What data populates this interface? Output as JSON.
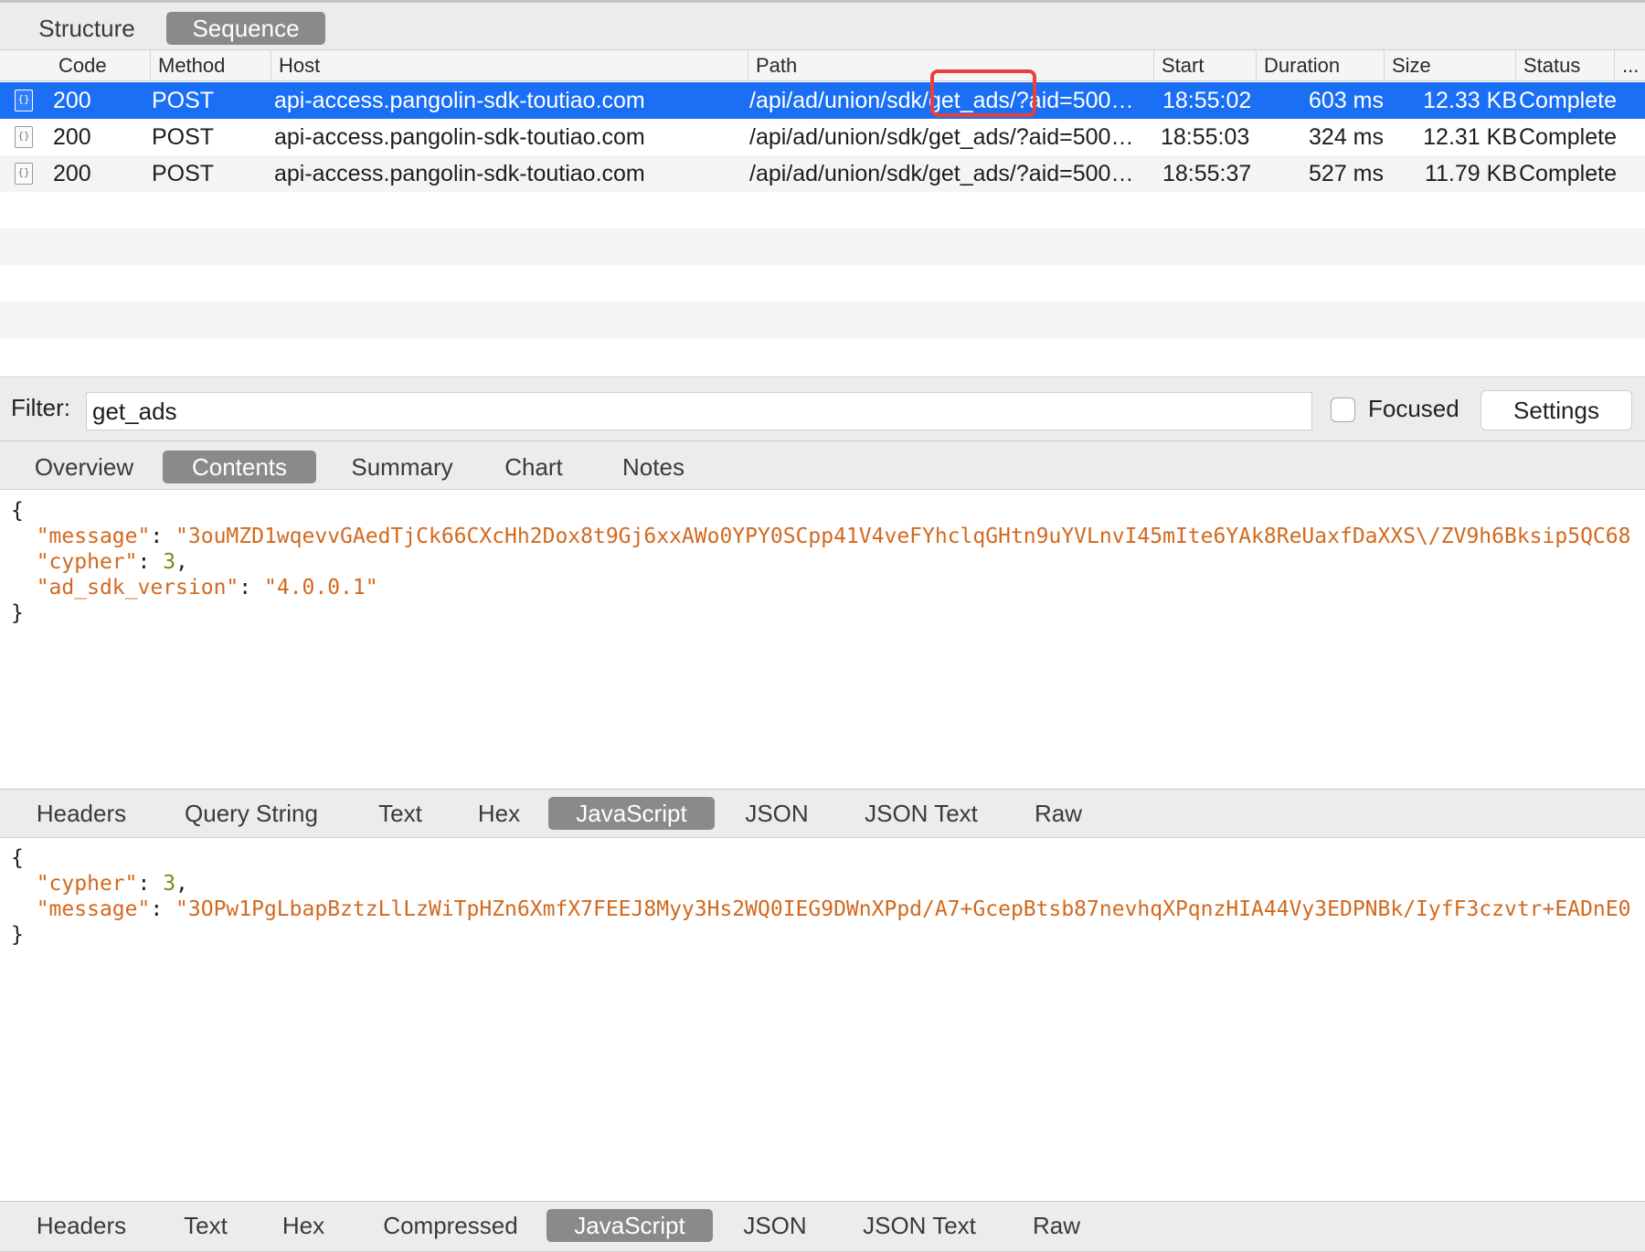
{
  "view_switch": {
    "tabs": [
      "Structure",
      "Sequence"
    ],
    "active": "Sequence"
  },
  "table": {
    "columns": [
      "Code",
      "Method",
      "Host",
      "Path",
      "Start",
      "Duration",
      "Size",
      "Status",
      "..."
    ],
    "rows": [
      {
        "code": "200",
        "method": "POST",
        "host": "api-access.pangolin-sdk-toutiao.com",
        "path": "/api/ad/union/sdk/get_ads/?aid=500…",
        "start": "18:55:02",
        "duration": "603 ms",
        "size": "12.33 KB",
        "status": "Complete",
        "selected": true
      },
      {
        "code": "200",
        "method": "POST",
        "host": "api-access.pangolin-sdk-toutiao.com",
        "path": "/api/ad/union/sdk/get_ads/?aid=500…",
        "start": "18:55:03",
        "duration": "324 ms",
        "size": "12.31 KB",
        "status": "Complete",
        "selected": false
      },
      {
        "code": "200",
        "method": "POST",
        "host": "api-access.pangolin-sdk-toutiao.com",
        "path": "/api/ad/union/sdk/get_ads/?aid=500…",
        "start": "18:55:37",
        "duration": "527 ms",
        "size": "11.79 KB",
        "status": "Complete",
        "selected": false
      }
    ],
    "row_icon": "json-document-icon",
    "highlight_color": "#e8403a",
    "selection_color": "#1a6ff5"
  },
  "filter": {
    "label": "Filter:",
    "value": "get_ads",
    "focused_label": "Focused",
    "focused_checked": false,
    "settings_label": "Settings"
  },
  "detail_tabs": {
    "tabs": [
      "Overview",
      "Contents",
      "Summary",
      "Chart",
      "Notes"
    ],
    "active": "Contents"
  },
  "request_body": {
    "open_brace": "{",
    "close_brace": "}",
    "message_key": "\"message\"",
    "message_value": "\"3ouMZD1wqevvGAedTjCk66CXcHh2Dox8t9Gj6xxAWo0YPY0SCpp41V4veFYhclqGHtn9uYVLnvI45mIte6YAk8ReUaxfDaXXS\\/ZV9h6Bksip5QC68",
    "cypher_key": "\"cypher\"",
    "cypher_value": "3",
    "sdk_key": "\"ad_sdk_version\"",
    "sdk_value": "\"4.0.0.1\""
  },
  "request_tabs": {
    "tabs": [
      "Headers",
      "Query String",
      "Text",
      "Hex",
      "JavaScript",
      "JSON",
      "JSON Text",
      "Raw"
    ],
    "active": "JavaScript"
  },
  "response_body": {
    "open_brace": "{",
    "close_brace": "}",
    "cypher_key": "\"cypher\"",
    "cypher_value": "3",
    "message_key": "\"message\"",
    "message_value": "\"3OPw1PgLbapBztzLlLzWiTpHZn6XmfX7FEEJ8Myy3Hs2WQ0IEG9DWnXPpd/A7+GcepBtsb87nevhqXPqnzHIA44Vy3EDPNBk/IyfF3czvtr+EADnE0"
  },
  "response_tabs": {
    "tabs": [
      "Headers",
      "Text",
      "Hex",
      "Compressed",
      "JavaScript",
      "JSON",
      "JSON Text",
      "Raw"
    ],
    "active": "JavaScript"
  }
}
